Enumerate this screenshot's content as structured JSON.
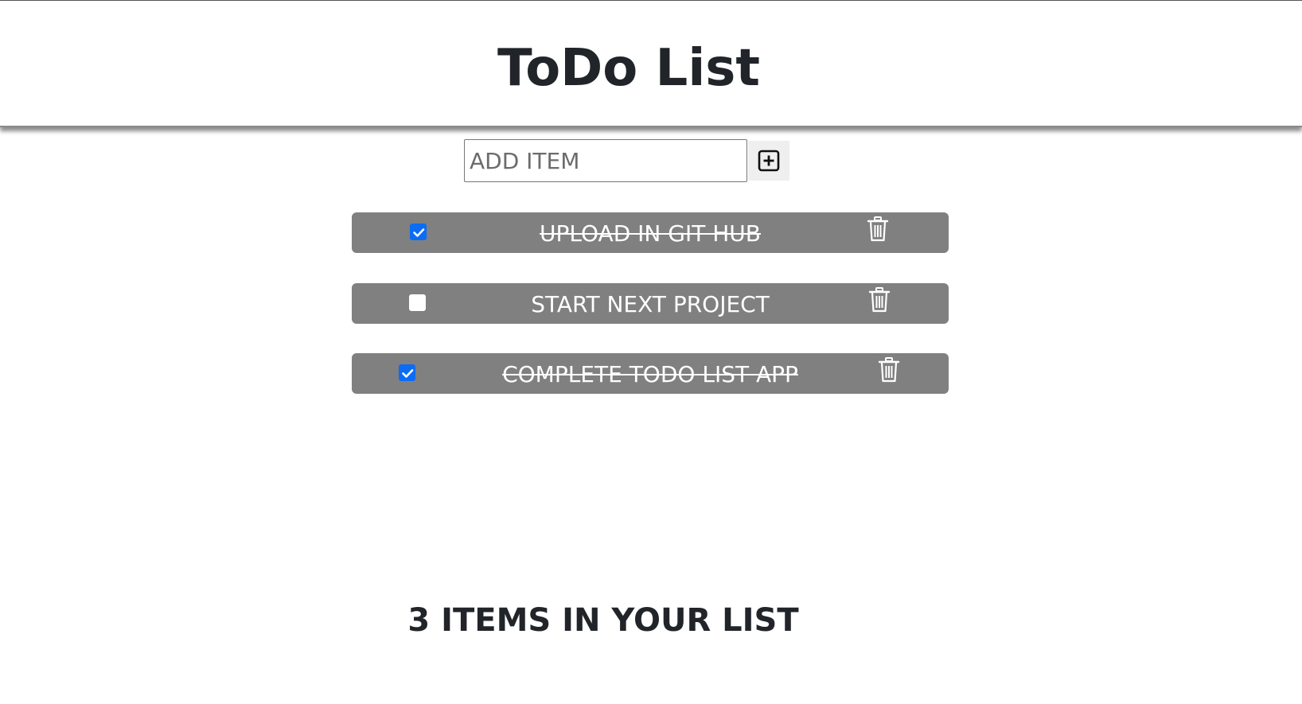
{
  "header": {
    "title": "ToDo List"
  },
  "add_item": {
    "placeholder": "ADD ITEM",
    "button_icon": "plus-square-icon"
  },
  "items": [
    {
      "label": "UPLOAD IN GIT HUB",
      "checked": true,
      "delete_icon": "trash-icon"
    },
    {
      "label": "START NEXT PROJECT",
      "checked": false,
      "delete_icon": "trash-icon"
    },
    {
      "label": "COMPLETE TODO LIST APP",
      "checked": true,
      "delete_icon": "trash-icon"
    }
  ],
  "footer": {
    "count_text": "3 ITEMS IN YOUR LIST"
  },
  "colors": {
    "item_background": "#808080",
    "checkbox_checked": "#0b6cf5",
    "text_dark": "#212529"
  }
}
